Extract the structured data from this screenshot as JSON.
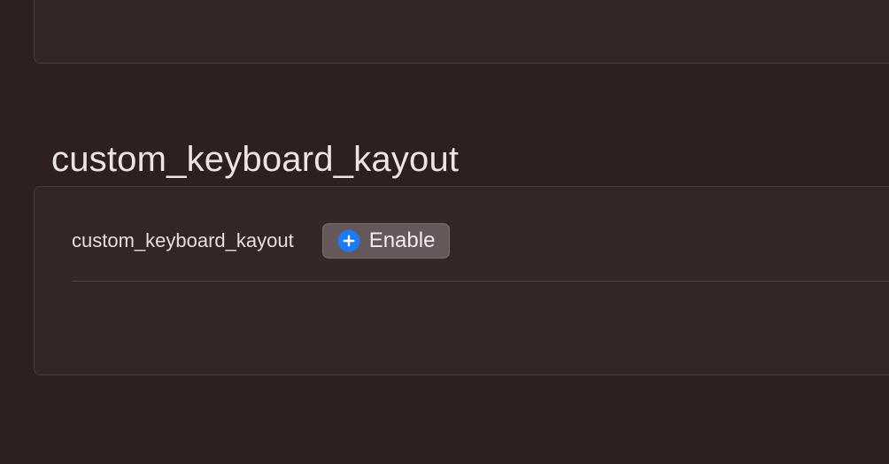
{
  "section": {
    "title": "custom_keyboard_kayout"
  },
  "setting": {
    "label": "custom_keyboard_kayout",
    "enable_button_label": "Enable",
    "button_icon": "plus-circle-icon"
  },
  "colors": {
    "background": "#2d201f",
    "panel": "#342624",
    "button": "#65585a",
    "accent": "#1a7cf5"
  }
}
